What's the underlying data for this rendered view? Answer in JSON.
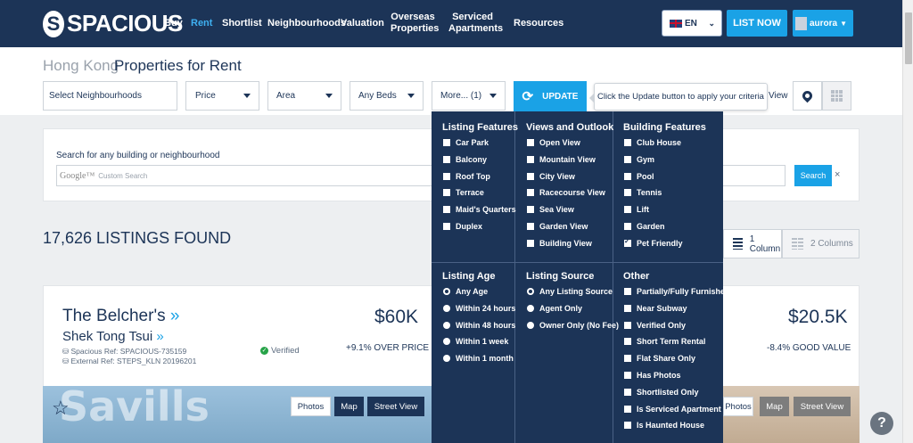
{
  "header": {
    "logo": "SPACIOUS",
    "nav": [
      {
        "label": "Buy"
      },
      {
        "label": "Rent"
      },
      {
        "label": "Shortlist"
      },
      {
        "label": "Neighbourhoods"
      },
      {
        "label": "Valuation"
      },
      {
        "label": "Overseas Properties"
      },
      {
        "label": "Serviced Apartments"
      },
      {
        "label": "Resources"
      }
    ],
    "language": "EN",
    "list_now": "LIST NOW",
    "user": "aurora"
  },
  "breadcrumb": {
    "region": "Hong Kong",
    "title": "Properties for Rent"
  },
  "filters": {
    "neighbourhoods": "Select Neighbourhoods",
    "price": "Price",
    "area": "Area",
    "beds": "Any Beds",
    "more": "More... (1)",
    "update": "UPDATE",
    "tooltip": "Click the Update button to apply your criteria",
    "view_label": "View"
  },
  "search": {
    "label": "Search for any building or neighbourhood",
    "google": "Google™",
    "placeholder": "Custom Search",
    "button": "Search",
    "clear": "×"
  },
  "listings": {
    "count": "17,626 LISTINGS FOUND",
    "one_column": "1 Column",
    "two_columns": "2 Columns"
  },
  "listing": {
    "name": "The Belcher's",
    "area": "Shek Tong Tsui",
    "spacious_ref": "Spacious Ref: SPACIOUS-735159",
    "external_ref": "External Ref: STEPS_KLN 20196201",
    "verified": "Verified",
    "price": "$60K",
    "price_note": "+9.1%  OVER PRICE",
    "watermark": "Savills",
    "photos": "Photos",
    "map": "Map",
    "street_view": "Street View"
  },
  "listing2": {
    "price": "$20.5K",
    "price_note": "-8.4%  GOOD VALUE",
    "photos": "Photos",
    "map": "Map",
    "street_view": "Street View"
  },
  "dropdown": {
    "listing_features": {
      "title": "Listing Features",
      "items": [
        "Car Park",
        "Balcony",
        "Roof Top",
        "Terrace",
        "Maid's Quarters",
        "Duplex"
      ]
    },
    "views": {
      "title": "Views and Outlook",
      "items": [
        "Open View",
        "Mountain View",
        "City View",
        "Racecourse View",
        "Sea View",
        "Garden View",
        "Building View"
      ]
    },
    "building": {
      "title": "Building Features",
      "items": [
        "Club House",
        "Gym",
        "Pool",
        "Tennis",
        "Lift",
        "Garden",
        "Pet Friendly"
      ],
      "checked": [
        6
      ]
    },
    "listing_age": {
      "title": "Listing Age",
      "items": [
        "Any Age",
        "Within 24 hours",
        "Within 48 hours",
        "Within 1 week",
        "Within 1 month"
      ],
      "selected": 0
    },
    "listing_source": {
      "title": "Listing Source",
      "items": [
        "Any Listing Source",
        "Agent Only",
        "Owner Only (No Fee)"
      ],
      "selected": 0
    },
    "other": {
      "title": "Other",
      "items": [
        "Partially/Fully Furnished",
        "Near Subway",
        "Verified Only",
        "Short Term Rental",
        "Flat Share Only",
        "Has Photos",
        "Shortlisted Only",
        "Is Serviced Apartment",
        "Is Haunted House"
      ]
    }
  },
  "colors": {
    "navy": "#1c3457",
    "accent": "#1aa2e6"
  }
}
